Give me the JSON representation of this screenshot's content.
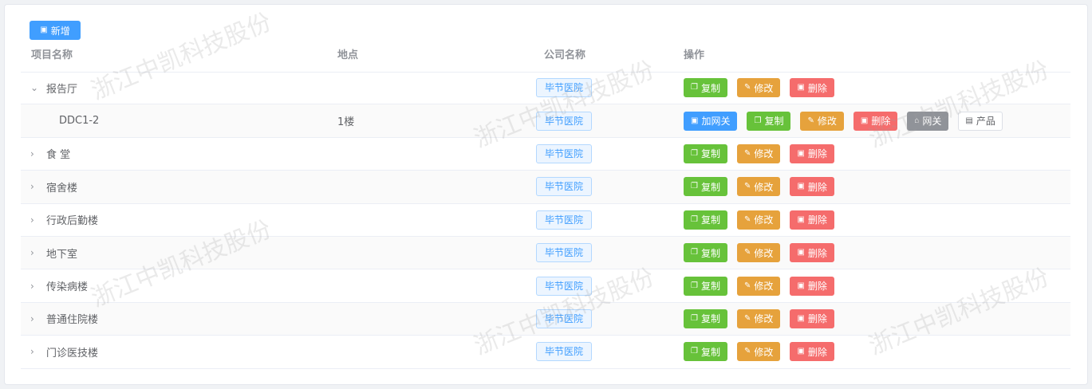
{
  "toolbar": {
    "add_label": "新增"
  },
  "table": {
    "headers": {
      "name": "项目名称",
      "location": "地点",
      "company": "公司名称",
      "actions": "操作"
    }
  },
  "actions": {
    "copy": "复制",
    "edit": "修改",
    "delete": "删除",
    "add_gateway": "加网关",
    "gateway": "网关",
    "product": "产品"
  },
  "rows": [
    {
      "name": "报告厅",
      "location": "",
      "company": "毕节医院",
      "expanded": true,
      "child": false
    },
    {
      "name": "DDC1-2",
      "location": "1楼",
      "company": "毕节医院",
      "expanded": false,
      "child": true
    },
    {
      "name": "食 堂",
      "location": "",
      "company": "毕节医院",
      "expanded": false,
      "child": false
    },
    {
      "name": "宿舍楼",
      "location": "",
      "company": "毕节医院",
      "expanded": false,
      "child": false
    },
    {
      "name": "行政后勤楼",
      "location": "",
      "company": "毕节医院",
      "expanded": false,
      "child": false
    },
    {
      "name": "地下室",
      "location": "",
      "company": "毕节医院",
      "expanded": false,
      "child": false
    },
    {
      "name": "传染病楼",
      "location": "",
      "company": "毕节医院",
      "expanded": false,
      "child": false
    },
    {
      "name": "普通住院楼",
      "location": "",
      "company": "毕节医院",
      "expanded": false,
      "child": false
    },
    {
      "name": "门诊医技楼",
      "location": "",
      "company": "毕节医院",
      "expanded": false,
      "child": false
    }
  ],
  "watermark": "浙江中凯科技股份",
  "icons": {
    "file": "file-icon",
    "copy": "copy-icon",
    "edit": "edit-icon",
    "delete": "delete-icon",
    "gateway": "gateway-icon",
    "product": "product-icon",
    "expand": "chevron-right-icon",
    "collapse": "chevron-down-icon"
  },
  "colors": {
    "primary": "#409eff",
    "success": "#67c23a",
    "warning": "#e6a23c",
    "danger": "#f56c6c",
    "info": "#909399"
  }
}
